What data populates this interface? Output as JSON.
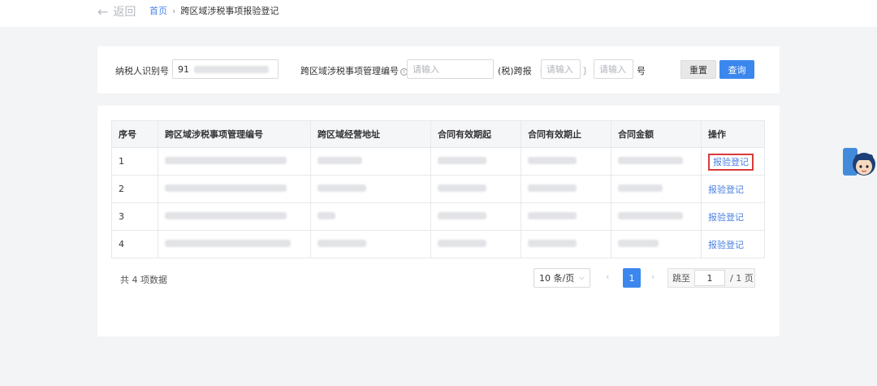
{
  "nav": {
    "back_label": "返回",
    "breadcrumb_home": "首页",
    "breadcrumb_sep": "›",
    "breadcrumb_current": "跨区域涉税事项报验登记"
  },
  "filter": {
    "taxpayer_id_label": "纳税人识别号",
    "taxpayer_id_value": "91",
    "mgmt_no_label": "跨区域涉税事项管理编号",
    "mgmt_no_placeholder": "请输入",
    "tax_cross_label": "(税)跨报",
    "bracket_open": "〔",
    "bracket_close": "〕",
    "year_placeholder": "请输入",
    "num_placeholder": "请输入",
    "hao_label": "号",
    "reset_label": "重置",
    "query_label": "查询"
  },
  "table": {
    "headers": [
      "序号",
      "跨区域涉税事项管理编号",
      "跨区域经营地址",
      "合同有效期起",
      "合同有效期止",
      "合同金额",
      "操作"
    ],
    "rows": [
      {
        "index": "1",
        "action": "报验登记"
      },
      {
        "index": "2",
        "action": "报验登记"
      },
      {
        "index": "3",
        "action": "报验登记"
      },
      {
        "index": "4",
        "action": "报验登记"
      }
    ]
  },
  "pagination": {
    "total_text": "共 4 项数据",
    "page_size": "10 条/页",
    "prev": "‹",
    "current_page": "1",
    "next": "›",
    "jump_label": "跳至",
    "jump_value": "1",
    "total_pages": "/ 1 页"
  },
  "colors": {
    "accent": "#3b87ee",
    "link": "#4a7fe0",
    "highlight": "#d93a3a",
    "page_bg": "#f3f4f6"
  }
}
